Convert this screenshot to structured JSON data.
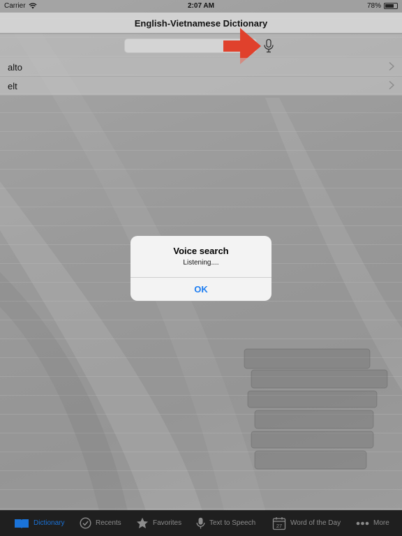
{
  "status_bar": {
    "carrier": "Carrier",
    "time": "2:07 AM",
    "battery": "78%",
    "battery_level": 0.78
  },
  "nav": {
    "title": "English-Vietnamese Dictionary"
  },
  "search": {
    "value": "",
    "placeholder": ""
  },
  "words": [
    {
      "label": "alto"
    },
    {
      "label": "elt"
    }
  ],
  "alert": {
    "title": "Voice search",
    "message": "Listening....",
    "ok_label": "OK"
  },
  "tabs": [
    {
      "label": "Dictionary",
      "icon": "book-icon",
      "active": true
    },
    {
      "label": "Recents",
      "icon": "checkmark-circle-icon",
      "active": false
    },
    {
      "label": "Favorites",
      "icon": "star-icon",
      "active": false
    },
    {
      "label": "Text to Speech",
      "icon": "microphone-icon",
      "active": false
    },
    {
      "label": "Word of the Day",
      "icon": "calendar-icon",
      "active": false,
      "day": "27"
    },
    {
      "label": "More",
      "icon": "more-dots-icon",
      "active": false
    }
  ],
  "colors": {
    "accent": "#1e7ef2",
    "tab_active": "#1a73d9",
    "tab_inactive": "#8c8c8c",
    "arrow": "#e0412c"
  }
}
